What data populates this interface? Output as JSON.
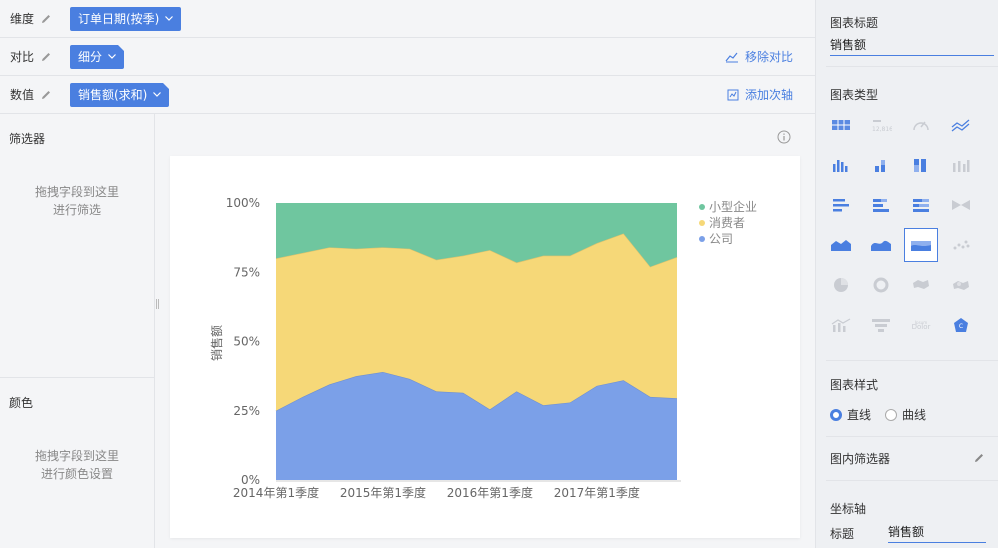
{
  "toolbar": {
    "dimension": {
      "label": "维度",
      "chip": "订单日期(按季)"
    },
    "compare": {
      "label": "对比",
      "chip": "细分",
      "action": "移除对比"
    },
    "value": {
      "label": "数值",
      "chip": "销售额(求和)",
      "action": "添加次轴"
    }
  },
  "left_panel": {
    "filter_title": "筛选器",
    "filter_hint_1": "拖拽字段到这里",
    "filter_hint_2": "进行筛选",
    "color_title": "颜色",
    "color_hint_1": "拖拽字段到这里",
    "color_hint_2": "进行颜色设置"
  },
  "right_panel": {
    "chart_title_label": "图表标题",
    "chart_title_value": "销售额",
    "chart_type_label": "图表类型",
    "chart_style_label": "图表样式",
    "style_options": [
      "直线",
      "曲线"
    ],
    "style_selected": "直线",
    "inner_filter_label": "图内筛选器",
    "axis_label": "坐标轴",
    "axis_title_label": "标题",
    "axis_title_value": "销售额",
    "chart_types": [
      "table-icon",
      "kpi-card-icon",
      "gauge-icon",
      "line-icon",
      "column-icon",
      "stacked-column-icon",
      "percent-column-icon",
      "range-column-icon",
      "bar-icon",
      "stacked-bar-icon",
      "percent-bar-icon",
      "butterfly-icon",
      "area-icon",
      "smooth-area-icon",
      "percent-area-icon",
      "scatter-icon",
      "pie-icon",
      "donut-icon",
      "map-icon",
      "bubble-map-icon",
      "combo-icon",
      "funnel-icon",
      "word-cloud-icon",
      "radar-icon"
    ],
    "chart_type_selected": "percent-area-icon"
  },
  "colors": {
    "accent": "#4a7fe0",
    "company": "#7ba0e8",
    "consumer": "#f6d878",
    "small_business": "#6fc69f"
  },
  "chart_data": {
    "type": "area",
    "stacking": "percent",
    "ylabel": "销售额",
    "xlabel": "",
    "ylim": [
      0,
      100
    ],
    "y_ticks": [
      "0%",
      "25%",
      "50%",
      "75%",
      "100%"
    ],
    "x_ticks": [
      "2014年第1季度",
      "2015年第1季度",
      "2016年第1季度",
      "2017年第1季度"
    ],
    "x_tick_indices": [
      0,
      4,
      8,
      12
    ],
    "n_points": 16,
    "legend_position": "top-right",
    "series": [
      {
        "name": "公司",
        "color": "#7ba0e8",
        "values": [
          25,
          30,
          34.5,
          37.5,
          39,
          36.5,
          32,
          31.5,
          25.5,
          32,
          27,
          28,
          34,
          36,
          30,
          29.5
        ]
      },
      {
        "name": "消费者",
        "color": "#f6d878",
        "values": [
          55,
          52,
          49.5,
          46,
          45,
          47,
          47.5,
          49.5,
          57.5,
          46.5,
          54,
          53,
          51.5,
          53,
          47,
          51
        ]
      },
      {
        "name": "小型企业",
        "color": "#6fc69f",
        "values": [
          20,
          18,
          16,
          16.5,
          16,
          16.5,
          20.5,
          19,
          17,
          21.5,
          19,
          19,
          14.5,
          11,
          23,
          19.5
        ]
      }
    ]
  }
}
